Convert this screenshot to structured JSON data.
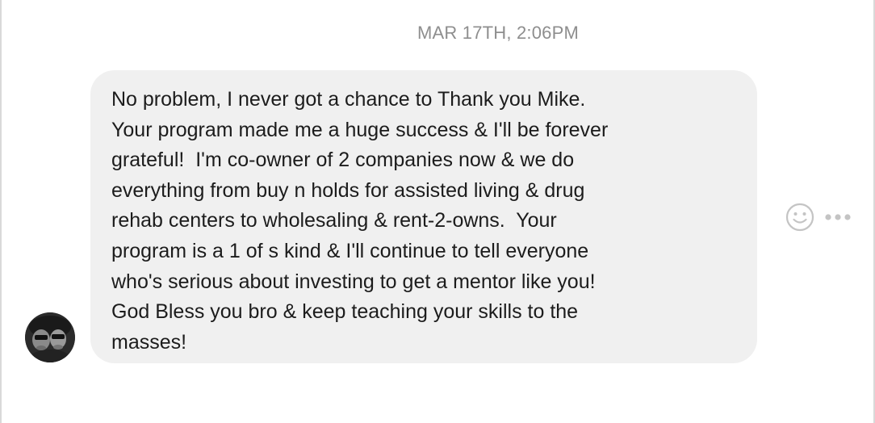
{
  "conversation": {
    "timestamp": "MAR 17TH, 2:06PM",
    "message": {
      "text": "No problem, I never got a chance to Thank you Mike.\nYour program made me a huge success & I'll be forever\ngrateful!  I'm co-owner of 2 companies now & we do\neverything from buy n holds for assisted living & drug\nrehab centers to wholesaling & rent-2-owns.  Your\nprogram is a 1 of s kind & I'll continue to tell everyone\nwho's serious about investing to get a mentor like you!\nGod Bless you bro & keep teaching your skills to the\nmasses!",
      "bubble_color": "#f0f0f0",
      "text_color": "#1c1c1c"
    },
    "actions": {
      "react_icon": "smiley-face-icon",
      "more_icon": "more-horizontal-icon"
    },
    "avatar": {
      "icon": "sender-avatar-photo"
    }
  }
}
